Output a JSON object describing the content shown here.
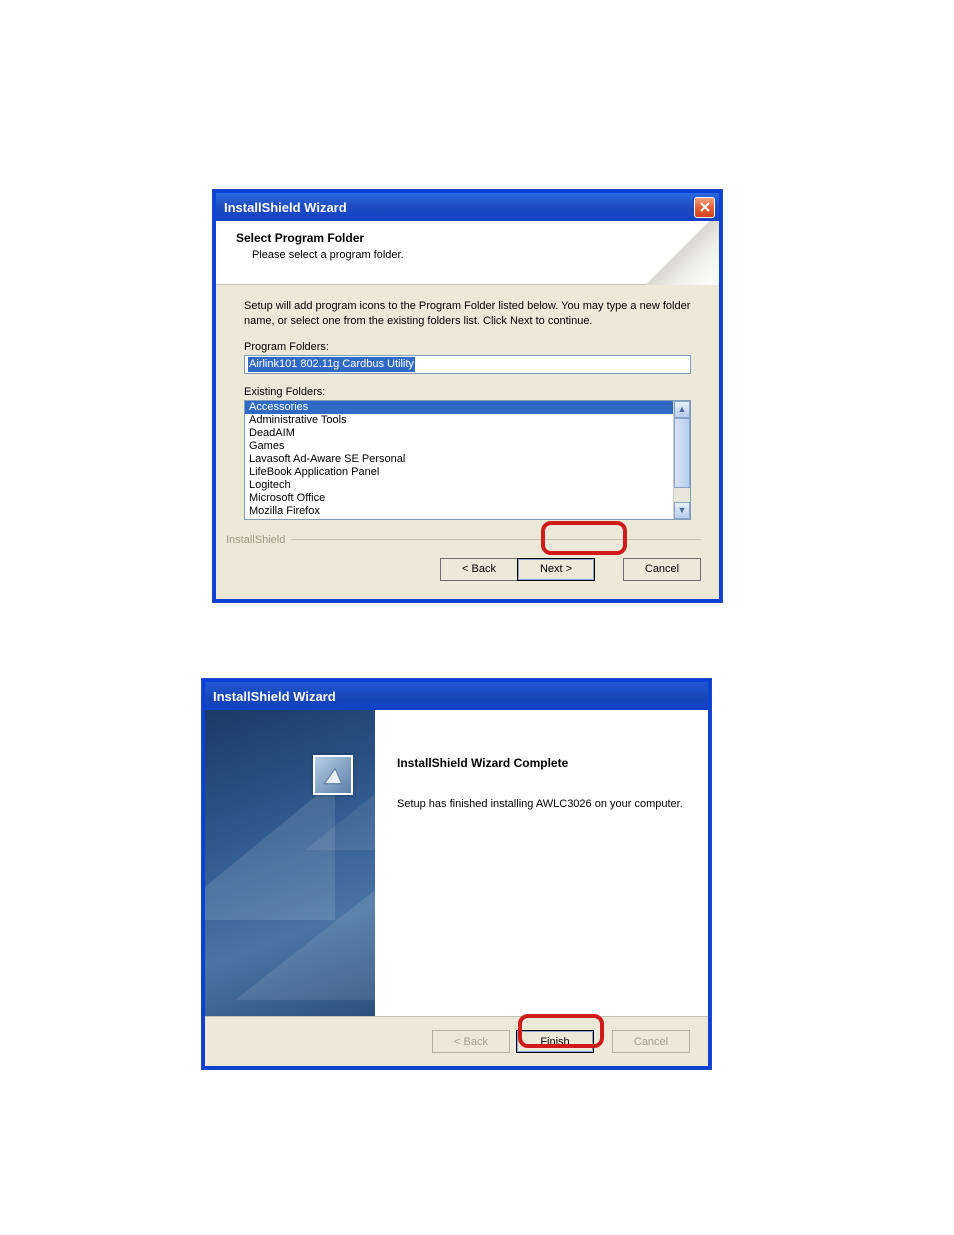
{
  "dialog1": {
    "title": "InstallShield Wizard",
    "header_title": "Select Program Folder",
    "header_sub": "Please select a program folder.",
    "description": "Setup will add program icons to the Program Folder listed below.  You may type a new folder name, or select one from the existing folders list.  Click Next to continue.",
    "program_folders_label": "Program Folders:",
    "program_folder_value": "Airlink101 802.11g Cardbus Utility",
    "existing_folders_label": "Existing Folders:",
    "existing_folders": [
      "Accessories",
      "Administrative Tools",
      "DeadAIM",
      "Games",
      "Lavasoft Ad-Aware SE Personal",
      "LifeBook Application Panel",
      "Logitech",
      "Microsoft Office",
      "Mozilla Firefox"
    ],
    "brand": "InstallShield",
    "back_label": "< Back",
    "next_label": "Next >",
    "cancel_label": "Cancel"
  },
  "dialog2": {
    "title": "InstallShield Wizard",
    "complete_title": "InstallShield Wizard Complete",
    "complete_text": "Setup has finished installing AWLC3026 on your computer.",
    "back_label": "< Back",
    "finish_label": "Finish",
    "cancel_label": "Cancel"
  }
}
